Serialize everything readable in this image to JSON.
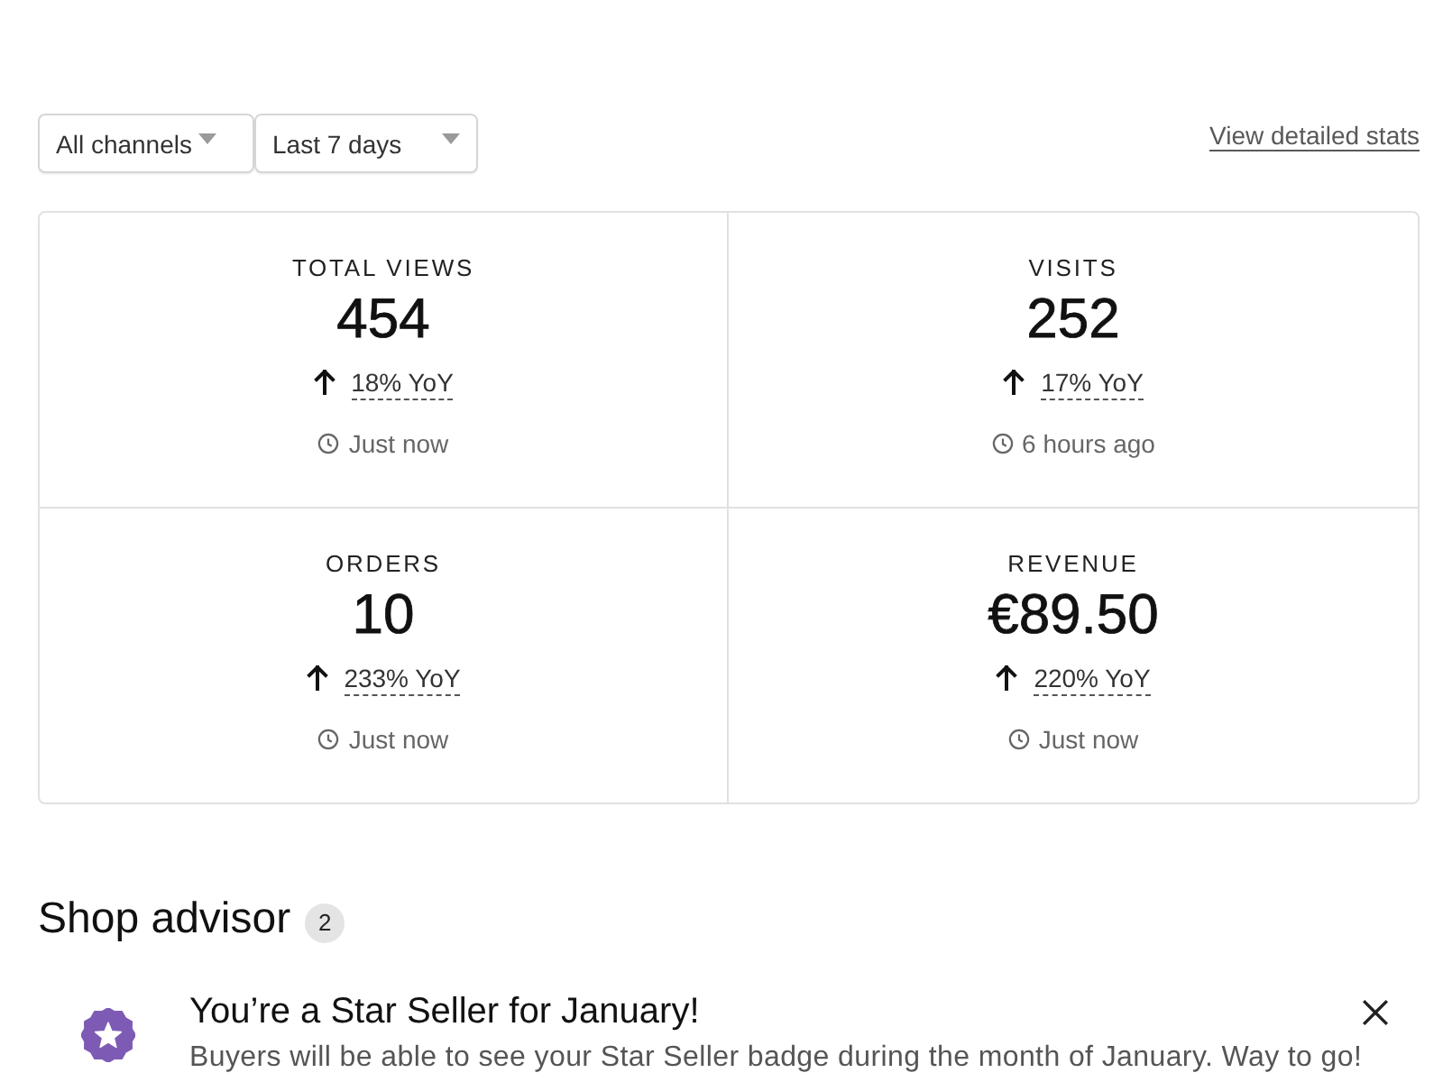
{
  "filters": [
    {
      "label": "All channels"
    },
    {
      "label": "Last 7 days"
    }
  ],
  "stats_link": "View detailed stats",
  "stats": [
    {
      "title": "TOTAL VIEWS",
      "value": "454",
      "increase": true,
      "change": "18% YoY",
      "updated": "Just now"
    },
    {
      "title": "VISITS",
      "value": "252",
      "increase": true,
      "change": "17% YoY",
      "updated": "6 hours ago"
    },
    {
      "title": "ORDERS",
      "value": "10",
      "increase": true,
      "change": "233% YoY",
      "updated": "Just now"
    },
    {
      "title": "REVENUE",
      "value": "€89.50",
      "increase": true,
      "change": "220% YoY",
      "updated": "Just now"
    }
  ],
  "shop_advisor": {
    "title": "Shop advisor",
    "count": "2",
    "notifications": [
      {
        "title": "You’re a Star Seller for January!",
        "body": "Buyers will be able to see your Star Seller badge during the month of January. Way to go!",
        "dismissible": true
      }
    ]
  }
}
